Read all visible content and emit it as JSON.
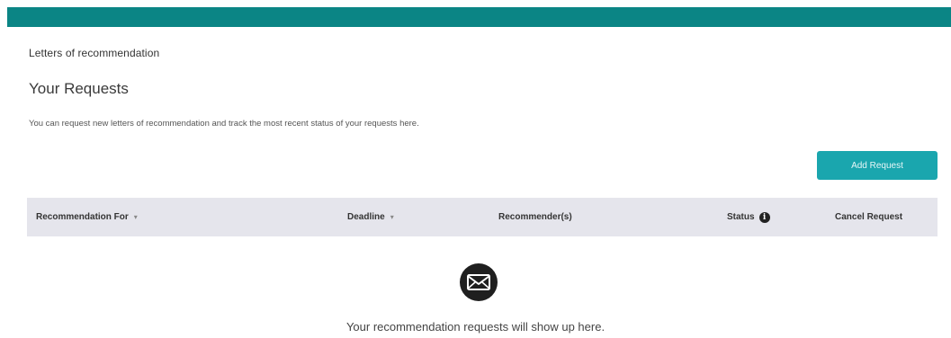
{
  "header": {
    "section_label": "Letters of recommendation",
    "title": "Your Requests",
    "description": "You can request new letters of recommendation and track the most recent status of your requests here.",
    "brand_color": "#0b8585"
  },
  "actions": {
    "add_request_label": "Add Request",
    "button_color": "#1aa6ae"
  },
  "table": {
    "columns": [
      {
        "label": "Recommendation For",
        "sortable": true
      },
      {
        "label": "Deadline",
        "sortable": true
      },
      {
        "label": "Recommender(s)",
        "sortable": false
      },
      {
        "label": "Status",
        "sortable": false,
        "icon": "info-icon"
      },
      {
        "label": "Cancel Request",
        "sortable": false
      }
    ],
    "sort_glyph": "▾",
    "status_info_glyph": "i",
    "rows": []
  },
  "empty_state": {
    "icon": "envelope-icon",
    "message": "Your recommendation requests will show up here."
  }
}
